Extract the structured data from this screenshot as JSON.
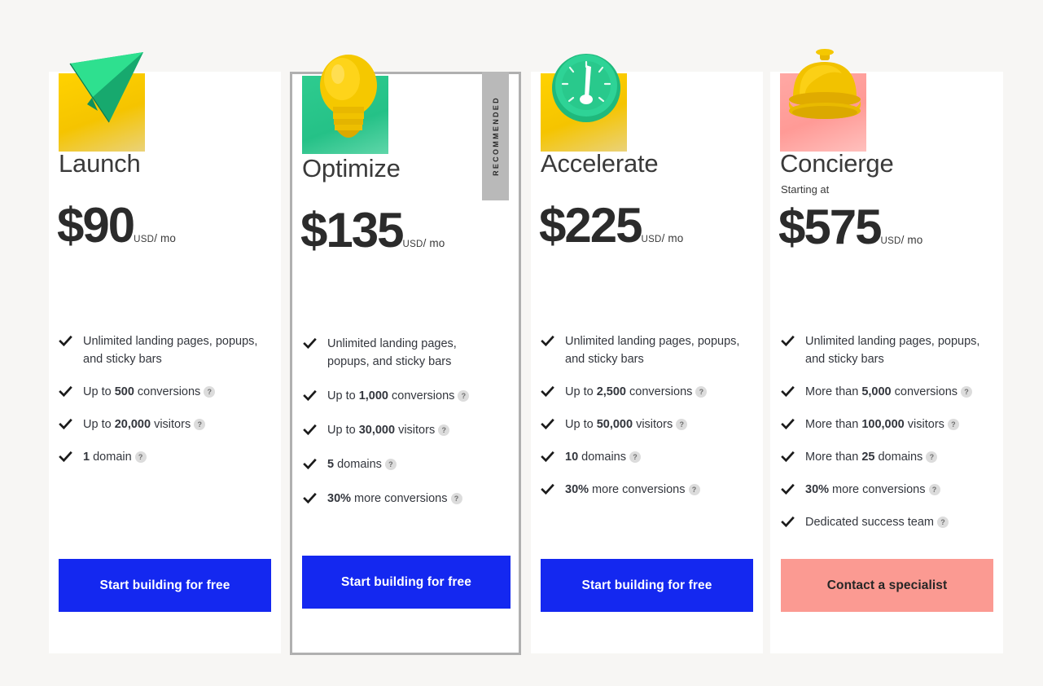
{
  "page": {
    "background_color": "#f7f6f4",
    "card_background": "#ffffff"
  },
  "colors": {
    "cta_primary": "#1428f0",
    "cta_secondary": "#fb9a92",
    "badge": "#b9b9b9",
    "accent_green": "#2ecc8f",
    "accent_yellow": "#ffd200",
    "accent_pink": "#ffa8a4",
    "price_text": "#2b2b2b",
    "body_text": "#33363d"
  },
  "currency_unit": {
    "currency": "USD",
    "separator": "/",
    "period": "mo"
  },
  "plans": [
    {
      "id": "launch",
      "title": "Launch",
      "starting_at_label": "",
      "price": "$90",
      "currency": "USD",
      "period": "/ mo",
      "icon_name": "paper-plane-icon",
      "square_color": "yellow",
      "recommended": false,
      "badge_label": "",
      "cta_label": "Start building for free",
      "cta_style": "blue",
      "features": [
        {
          "prefix": "Unlimited landing pages, popups, and sticky bars",
          "bold": "",
          "suffix": "",
          "help": false
        },
        {
          "prefix": "Up to ",
          "bold": "500",
          "suffix": " conversions",
          "help": true
        },
        {
          "prefix": "Up to ",
          "bold": "20,000",
          "suffix": " visitors",
          "help": true
        },
        {
          "prefix": "",
          "bold": "1",
          "suffix": " domain",
          "help": true
        }
      ]
    },
    {
      "id": "optimize",
      "title": "Optimize",
      "starting_at_label": "",
      "price": "$135",
      "currency": "USD",
      "period": "/ mo",
      "icon_name": "lightbulb-icon",
      "square_color": "green",
      "recommended": true,
      "badge_label": "RECOMMENDED",
      "cta_label": "Start building for free",
      "cta_style": "blue",
      "features": [
        {
          "prefix": "Unlimited landing pages, popups, and sticky bars",
          "bold": "",
          "suffix": "",
          "help": false
        },
        {
          "prefix": "Up to ",
          "bold": "1,000",
          "suffix": " conversions",
          "help": true
        },
        {
          "prefix": "Up to ",
          "bold": "30,000",
          "suffix": " visitors",
          "help": true
        },
        {
          "prefix": "",
          "bold": "5",
          "suffix": " domains",
          "help": true
        },
        {
          "prefix": "",
          "bold": "30%",
          "suffix": " more conversions",
          "help": true
        }
      ]
    },
    {
      "id": "accelerate",
      "title": "Accelerate",
      "starting_at_label": "",
      "price": "$225",
      "currency": "USD",
      "period": "/ mo",
      "icon_name": "speedometer-icon",
      "square_color": "yellow",
      "recommended": false,
      "badge_label": "",
      "cta_label": "Start building for free",
      "cta_style": "blue",
      "features": [
        {
          "prefix": "Unlimited landing pages, popups, and sticky bars",
          "bold": "",
          "suffix": "",
          "help": false
        },
        {
          "prefix": "Up to ",
          "bold": "2,500",
          "suffix": " conversions",
          "help": true
        },
        {
          "prefix": "Up to ",
          "bold": "50,000",
          "suffix": " visitors",
          "help": true
        },
        {
          "prefix": "",
          "bold": "10",
          "suffix": " domains",
          "help": true
        },
        {
          "prefix": "",
          "bold": "30%",
          "suffix": " more conversions",
          "help": true
        }
      ]
    },
    {
      "id": "concierge",
      "title": "Concierge",
      "starting_at_label": "Starting at",
      "price": "$575",
      "currency": "USD",
      "period": "/ mo",
      "icon_name": "service-bell-icon",
      "square_color": "pink",
      "recommended": false,
      "badge_label": "",
      "cta_label": "Contact a specialist",
      "cta_style": "pink",
      "features": [
        {
          "prefix": "Unlimited landing pages, popups, and sticky bars",
          "bold": "",
          "suffix": "",
          "help": false
        },
        {
          "prefix": "More than ",
          "bold": "5,000",
          "suffix": " conversions",
          "help": true
        },
        {
          "prefix": "More than ",
          "bold": "100,000",
          "suffix": " visitors",
          "help": true
        },
        {
          "prefix": "More than ",
          "bold": "25",
          "suffix": " domains",
          "help": true
        },
        {
          "prefix": "",
          "bold": "30%",
          "suffix": " more conversions",
          "help": true
        },
        {
          "prefix": "Dedicated success team",
          "bold": "",
          "suffix": "",
          "help": true
        }
      ]
    }
  ],
  "help_icon_glyph": "?"
}
